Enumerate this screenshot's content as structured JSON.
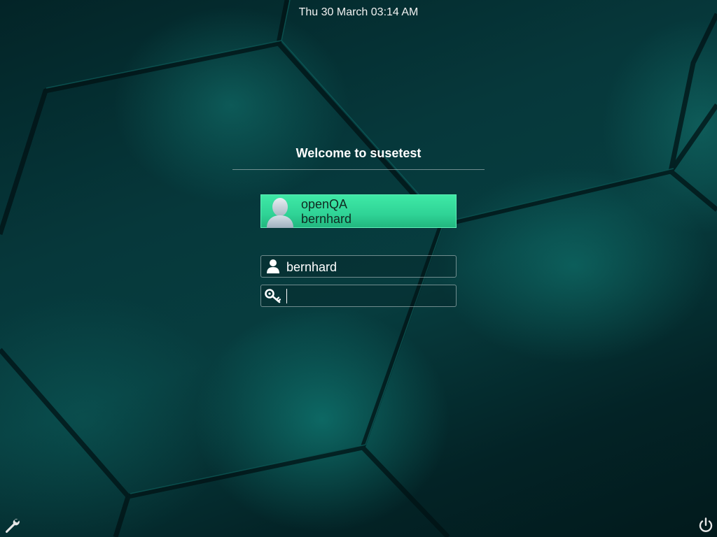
{
  "top_bar": {
    "clock": "Thu 30 March 03:14 AM"
  },
  "greeter": {
    "welcome": "Welcome to susetest",
    "selected_user": {
      "full_name": "openQA",
      "username": "bernhard",
      "avatar_icon": "user-avatar-icon"
    },
    "username_field": {
      "icon": "user-icon",
      "value": "bernhard"
    },
    "password_field": {
      "icon": "key-icon",
      "value": ""
    }
  },
  "bottom_bar": {
    "left_icon": "wrench-icon",
    "right_icon": "power-icon"
  },
  "colors": {
    "accent": "#35dd9c",
    "background": "#053235"
  }
}
